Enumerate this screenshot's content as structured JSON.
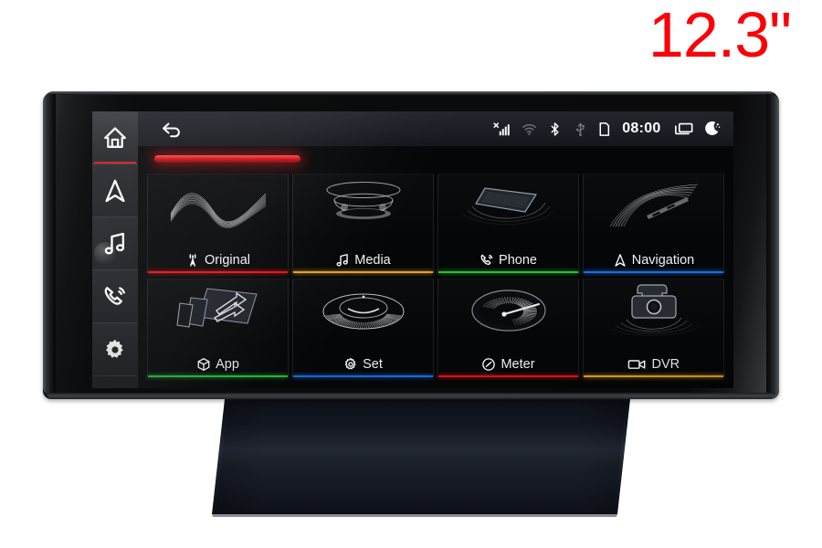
{
  "badge": {
    "text": "12.3\"",
    "color": "#fb0007"
  },
  "statusbar": {
    "back_icon": "back-arrow-icon",
    "icons": [
      {
        "name": "signal-off-icon",
        "dim": false
      },
      {
        "name": "wifi-icon",
        "dim": true
      },
      {
        "name": "bluetooth-icon",
        "dim": false
      },
      {
        "name": "usb-icon",
        "dim": true
      },
      {
        "name": "sim-card-icon",
        "dim": false
      }
    ],
    "clock": "08:00",
    "right_icons": [
      {
        "name": "multitask-windows-icon",
        "dim": false
      },
      {
        "name": "night-mode-moon-icon",
        "dim": false
      }
    ]
  },
  "sidebar": {
    "items": [
      {
        "name": "home",
        "icon": "home-icon",
        "active": true
      },
      {
        "name": "navigation",
        "icon": "navigation-arrow-icon",
        "active": false
      },
      {
        "name": "music",
        "icon": "music-note-icon",
        "active": false
      },
      {
        "name": "phone",
        "icon": "phone-icon",
        "active": false
      },
      {
        "name": "settings",
        "icon": "gear-icon",
        "active": false
      }
    ]
  },
  "home": {
    "tiles": [
      {
        "label": "Original",
        "icon": "radio-tower-icon",
        "accent": "#e81016",
        "art": "waveform"
      },
      {
        "label": "Media",
        "icon": "music-note-icon",
        "accent": "#e8a21a",
        "art": "speaker"
      },
      {
        "label": "Phone",
        "icon": "phone-icon",
        "accent": "#25c13c",
        "art": "phone-device"
      },
      {
        "label": "Navigation",
        "icon": "nav-arrow-icon",
        "accent": "#1170e8",
        "art": "road"
      },
      {
        "label": "App",
        "icon": "cube-icon",
        "accent": "#25c13c",
        "art": "apps-share"
      },
      {
        "label": "Set",
        "icon": "gear-icon",
        "accent": "#1170e8",
        "art": "dial"
      },
      {
        "label": "Meter",
        "icon": "gauge-icon",
        "accent": "#e81016",
        "art": "speedometer"
      },
      {
        "label": "DVR",
        "icon": "camcorder-icon",
        "accent": "#e8a21a",
        "art": "dashcam"
      }
    ]
  },
  "device": {
    "screen_accent_bar_color": "#cf1016"
  }
}
